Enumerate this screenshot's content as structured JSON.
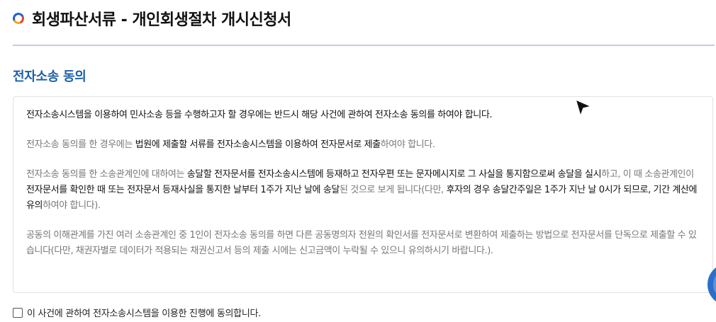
{
  "page_title": "회생파산서류 - 개인회생절차 개시신청서",
  "section_heading": "전자소송 동의",
  "consent": {
    "paragraph1": "전자소송시스템을 이용하여 민사소송 등을 수행하고자 할 경우에는 반드시 해당 사건에 관하여 전자소송 동의를 하여야 합니다.",
    "paragraph2": {
      "a": "전자소송 동의를 한 경우에는 ",
      "b": "법원에 제출할 서류를 전자소송시스템을 이용하여 전자문서로 제출",
      "c": "하여야 합니다."
    },
    "paragraph3": {
      "a": "전자소송 동의를 한 소송관계인에 대하여는 ",
      "b": "송달할 전자문서를 전자소송시스템에 등재하고 전자우편 또는 문자메시지로 그 사실을 통지함으로써 송달을 실시",
      "c": "하고, 이 때 소송관계인이 ",
      "d": "전자문서를 확인한 때 또는 전자문서 등재사실을 통지한 날부터 1주가 지난 날에 송달",
      "e": "된 것으로 보게 됩니다(다만, ",
      "f": "후자의 경우 송달간주일은 1주가 지난 날 0시가 되므로, 기간 계산에 유의",
      "g": "하여야 합니다)."
    },
    "paragraph4": "공동의 이해관계를 가진 여러 소송관계인 중 1인이 전자소송 동의를 하면 다른 공동명의자 전원의 확인서를 전자문서로 변환하여 제출하는 방법으로 전자문서를 단독으로 제출할 수 있습니다(다만, 채권자별로 데이터가 적용되는 채권신고서 등의 제출 시에는 신고금액이 누락될 수 있으니 유의하시기 바랍니다.)."
  },
  "agree": {
    "label": "이 사건에 관하여 전자소송시스템을 이용한 진행에 동의합니다.",
    "checked": false
  },
  "colors": {
    "heading_blue": "#1c5ea8",
    "divider": "#c9c9e6",
    "floating_button": "#2b6fc9"
  }
}
